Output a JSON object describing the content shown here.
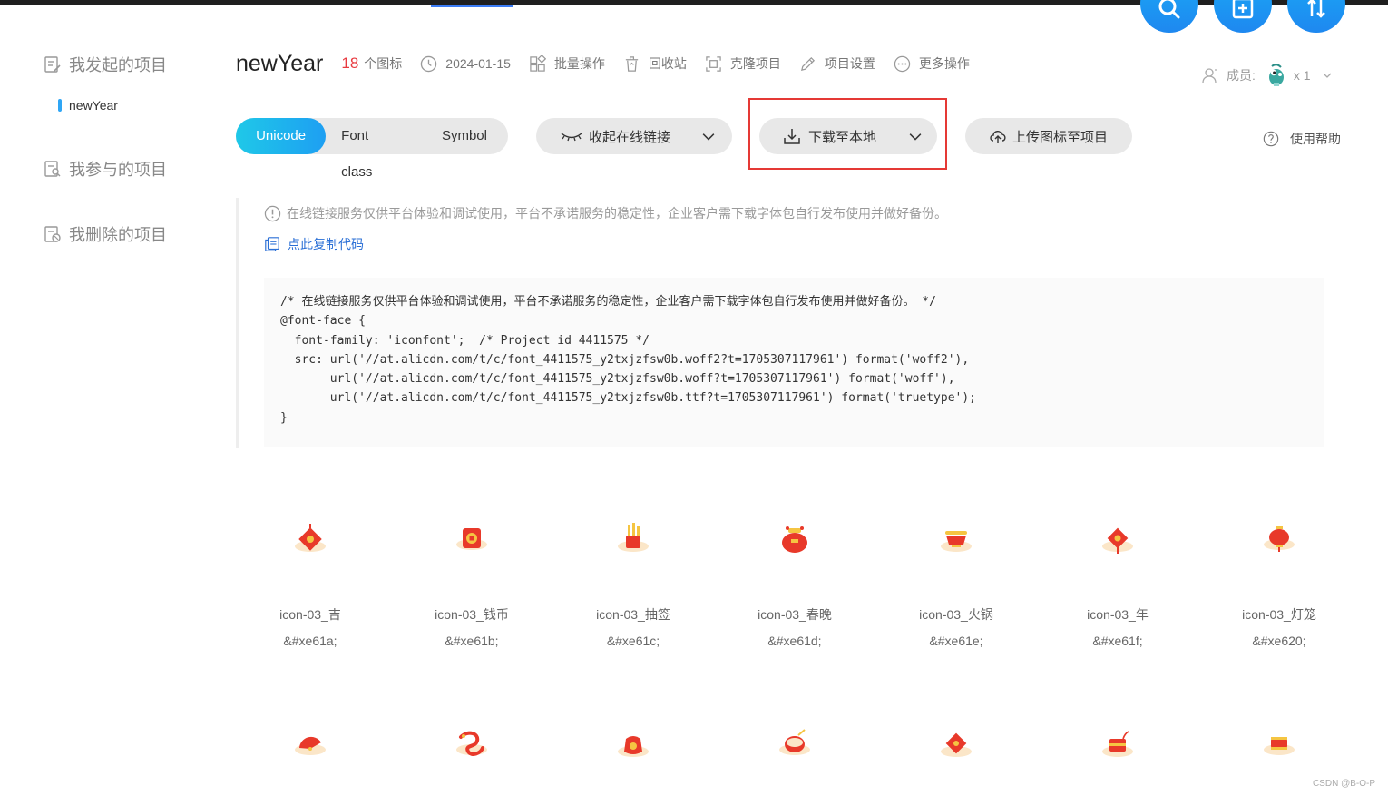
{
  "sidebar": {
    "items": [
      {
        "label": "我发起的项目"
      },
      {
        "label": "我参与的项目"
      },
      {
        "label": "我删除的项目"
      }
    ],
    "current_project": "newYear"
  },
  "header": {
    "title": "newYear",
    "icon_count": "18",
    "icon_count_suffix": "个图标",
    "date": "2024-01-15",
    "ops": [
      {
        "label": "批量操作",
        "icon": "batch-icon"
      },
      {
        "label": "回收站",
        "icon": "trash-icon"
      },
      {
        "label": "克隆项目",
        "icon": "clone-icon"
      },
      {
        "label": "项目设置",
        "icon": "edit-icon"
      },
      {
        "label": "更多操作",
        "icon": "more-icon"
      }
    ],
    "members_label": "成员:",
    "members_count": "x 1"
  },
  "toolbar": {
    "tabs": [
      {
        "label": "Unicode",
        "active": true
      },
      {
        "label": "Font class",
        "active": false
      },
      {
        "label": "Symbol",
        "active": false
      }
    ],
    "collapse_label": "收起在线链接",
    "download_label": "下载至本地",
    "upload_label": "上传图标至项目",
    "help_label": "使用帮助"
  },
  "notice": {
    "text": "在线链接服务仅供平台体验和调试使用，平台不承诺服务的稳定性，企业客户需下载字体包自行发布使用并做好备份。",
    "copy_label": "点此复制代码"
  },
  "code_lines": [
    "/* 在线链接服务仅供平台体验和调试使用，平台不承诺服务的稳定性，企业客户需下载字体包自行发布使用并做好备份。 */",
    "@font-face {",
    "  font-family: 'iconfont';  /* Project id 4411575 */",
    "  src: url('//at.alicdn.com/t/c/font_4411575_y2txjzfsw0b.woff2?t=1705307117961') format('woff2'),",
    "       url('//at.alicdn.com/t/c/font_4411575_y2txjzfsw0b.woff?t=1705307117961') format('woff'),",
    "       url('//at.alicdn.com/t/c/font_4411575_y2txjzfsw0b.ttf?t=1705307117961') format('truetype');",
    "}"
  ],
  "icons_row1": [
    {
      "name": "icon-03_吉",
      "code": "&#xe61a;"
    },
    {
      "name": "icon-03_钱币",
      "code": "&#xe61b;"
    },
    {
      "name": "icon-03_抽签",
      "code": "&#xe61c;"
    },
    {
      "name": "icon-03_春晚",
      "code": "&#xe61d;"
    },
    {
      "name": "icon-03_火锅",
      "code": "&#xe61e;"
    },
    {
      "name": "icon-03_年",
      "code": "&#xe61f;"
    },
    {
      "name": "icon-03_灯笼",
      "code": "&#xe620;"
    }
  ],
  "watermark": "CSDN @B-O-P",
  "colors": {
    "accent": "#1e9ff2",
    "count": "#e8393f",
    "link": "#2a6fd6",
    "highlight": "#e53935"
  }
}
